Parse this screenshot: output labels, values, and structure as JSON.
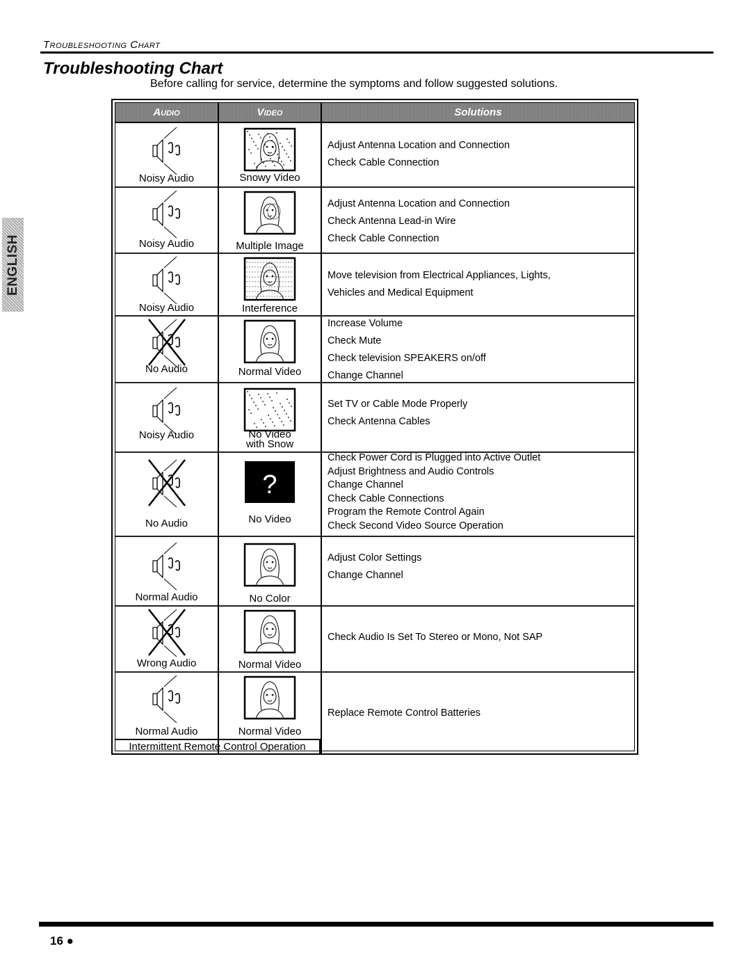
{
  "running_head": "Troubleshooting Chart",
  "title": "Troubleshooting Chart",
  "intro": "Before calling for service, determine the symptoms and follow suggested solutions.",
  "side_tab": "ENGLISH",
  "table": {
    "headers": {
      "audio": "Audio",
      "video": "Video",
      "solutions": "Solutions"
    },
    "rows": [
      {
        "audio": "Noisy Audio",
        "audio_icon": "speaker-notes-icon",
        "video": "Snowy Video",
        "video_icon": "tv-snowy-icon",
        "solutions": [
          "Adjust Antenna Location and Connection",
          "Check Cable Connection"
        ]
      },
      {
        "audio": "Noisy Audio",
        "audio_icon": "speaker-notes-icon",
        "video": "Multiple Image",
        "video_icon": "tv-multiple-image-icon",
        "solutions": [
          "Adjust Antenna Location and Connection",
          "Check Antenna Lead-in Wire",
          "Check Cable Connection"
        ]
      },
      {
        "audio": "Noisy Audio",
        "audio_icon": "speaker-notes-icon",
        "video": "Interference",
        "video_icon": "tv-interference-icon",
        "solutions": [
          "Move television from Electrical Appliances, Lights,",
          "Vehicles and Medical Equipment"
        ]
      },
      {
        "audio": "No Audio",
        "audio_icon": "speaker-crossed-icon",
        "video": "Normal Video",
        "video_icon": "tv-normal-icon",
        "solutions": [
          "Increase Volume",
          "Check Mute",
          "Check television SPEAKERS on/off",
          "Change Channel"
        ]
      },
      {
        "audio": "Noisy Audio",
        "audio_icon": "speaker-notes-icon",
        "video": "No Video with Snow",
        "video_icon": "tv-snow-only-icon",
        "solutions": [
          "Set TV or Cable Mode Properly",
          "Check Antenna Cables"
        ]
      },
      {
        "audio": "No Audio",
        "audio_icon": "speaker-crossed-icon",
        "video": "No Video",
        "video_icon": "tv-no-video-icon",
        "no_video_glyph": "?",
        "solutions": [
          "Check Power Cord is Plugged into Active Outlet",
          "Adjust Brightness and Audio Controls",
          "Change Channel",
          "Check Cable Connections",
          "Program the Remote Control Again",
          "Check Second Video Source Operation"
        ]
      },
      {
        "audio": "Normal Audio",
        "audio_icon": "speaker-notes-icon",
        "video": "No Color",
        "video_icon": "tv-normal-icon",
        "solutions": [
          "Adjust Color Settings",
          "Change Channel"
        ]
      },
      {
        "audio": "Wrong Audio",
        "audio_icon": "speaker-crossed-icon",
        "video": "Normal Video",
        "video_icon": "tv-normal-icon",
        "solutions": [
          "Check Audio Is Set To Stereo or Mono, Not SAP"
        ]
      },
      {
        "audio": "Normal Audio",
        "audio_icon": "speaker-notes-icon",
        "video": "Normal Video",
        "video_icon": "tv-normal-icon",
        "span_label": "Intermittent Remote Control Operation",
        "solutions": [
          "Replace Remote Control Batteries"
        ]
      }
    ]
  },
  "page_number": "16",
  "page_bullet": "●"
}
